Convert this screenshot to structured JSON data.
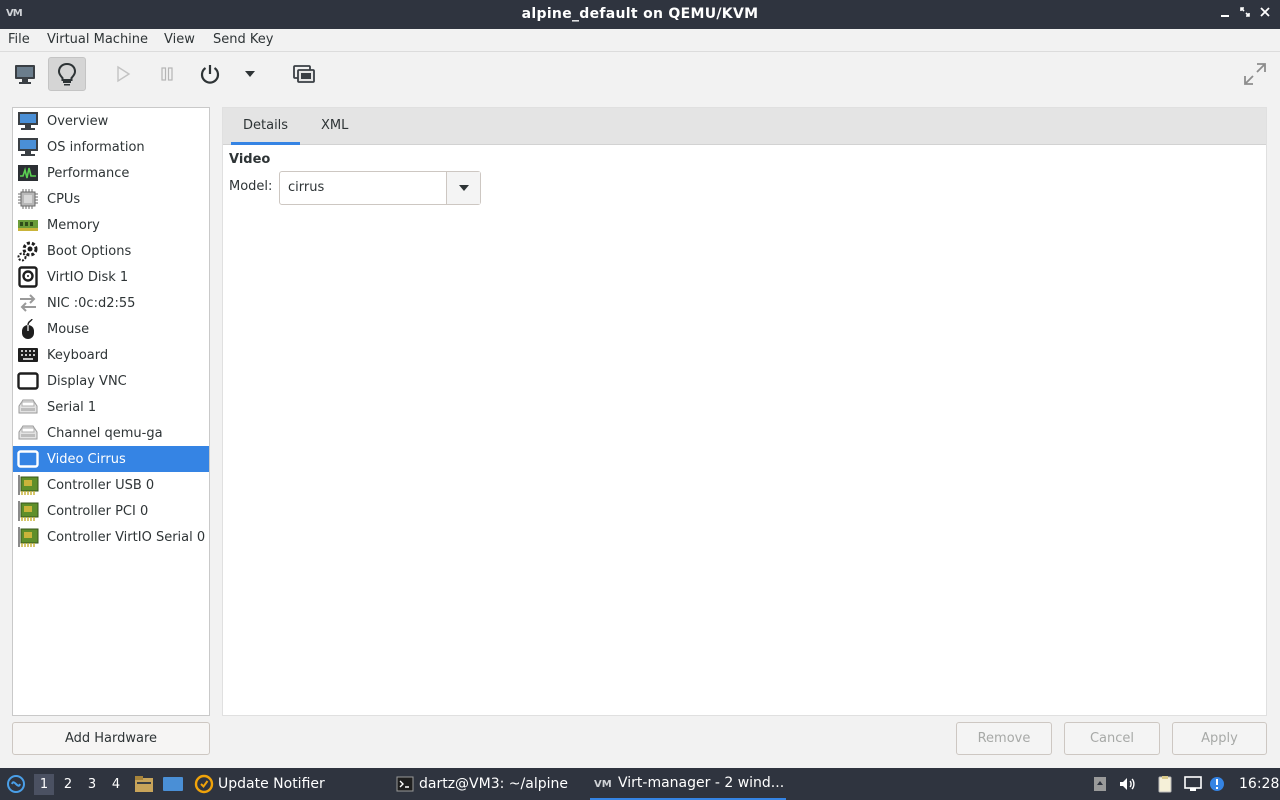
{
  "window": {
    "title": "alpine_default on QEMU/KVM",
    "app_icon": "VM"
  },
  "menubar": {
    "items": [
      "File",
      "Virtual Machine",
      "View",
      "Send Key"
    ]
  },
  "toolbar": {
    "buttons": [
      "console-icon",
      "details-icon",
      "run-icon",
      "pause-icon",
      "power-icon",
      "power-menu-icon",
      "snapshot-icon",
      "fullscreen-icon"
    ]
  },
  "sidebar": {
    "selected_index": 13,
    "items": [
      {
        "label": "Overview",
        "icon": "monitor-icon"
      },
      {
        "label": "OS information",
        "icon": "monitor-icon"
      },
      {
        "label": "Performance",
        "icon": "performance-icon"
      },
      {
        "label": "CPUs",
        "icon": "cpu-icon"
      },
      {
        "label": "Memory",
        "icon": "memory-icon"
      },
      {
        "label": "Boot Options",
        "icon": "gear-icon"
      },
      {
        "label": "VirtIO Disk 1",
        "icon": "disk-icon"
      },
      {
        "label": "NIC :0c:d2:55",
        "icon": "network-icon"
      },
      {
        "label": "Mouse",
        "icon": "mouse-icon"
      },
      {
        "label": "Keyboard",
        "icon": "keyboard-icon"
      },
      {
        "label": "Display VNC",
        "icon": "display-icon"
      },
      {
        "label": "Serial 1",
        "icon": "serial-icon"
      },
      {
        "label": "Channel qemu-ga",
        "icon": "serial-icon"
      },
      {
        "label": "Video Cirrus",
        "icon": "display-icon"
      },
      {
        "label": "Controller USB 0",
        "icon": "controller-icon"
      },
      {
        "label": "Controller PCI 0",
        "icon": "controller-icon"
      },
      {
        "label": "Controller VirtIO Serial 0",
        "icon": "controller-icon"
      }
    ],
    "add_hardware_label": "Add Hardware"
  },
  "details": {
    "tabs": [
      "Details",
      "XML"
    ],
    "active_tab": "Details",
    "section_title": "Video",
    "model_label": "Model:",
    "model_value": "cirrus"
  },
  "actions": {
    "remove": "Remove",
    "cancel": "Cancel",
    "apply": "Apply"
  },
  "taskbar": {
    "workspaces": [
      "1",
      "2",
      "3",
      "4"
    ],
    "active_workspace": "1",
    "tasks": [
      {
        "label": "Update Notifier",
        "icon": "update-notifier-icon"
      },
      {
        "label": "dartz@VM3: ~/alpine",
        "icon": "terminal-icon"
      },
      {
        "label": "Virt-manager - 2 wind...",
        "icon": "virt-manager-icon"
      }
    ],
    "clock": "16:28"
  },
  "colors": {
    "accent": "#3584e4",
    "titlebar": "#2f343f",
    "window_bg": "#f2f2f2"
  }
}
